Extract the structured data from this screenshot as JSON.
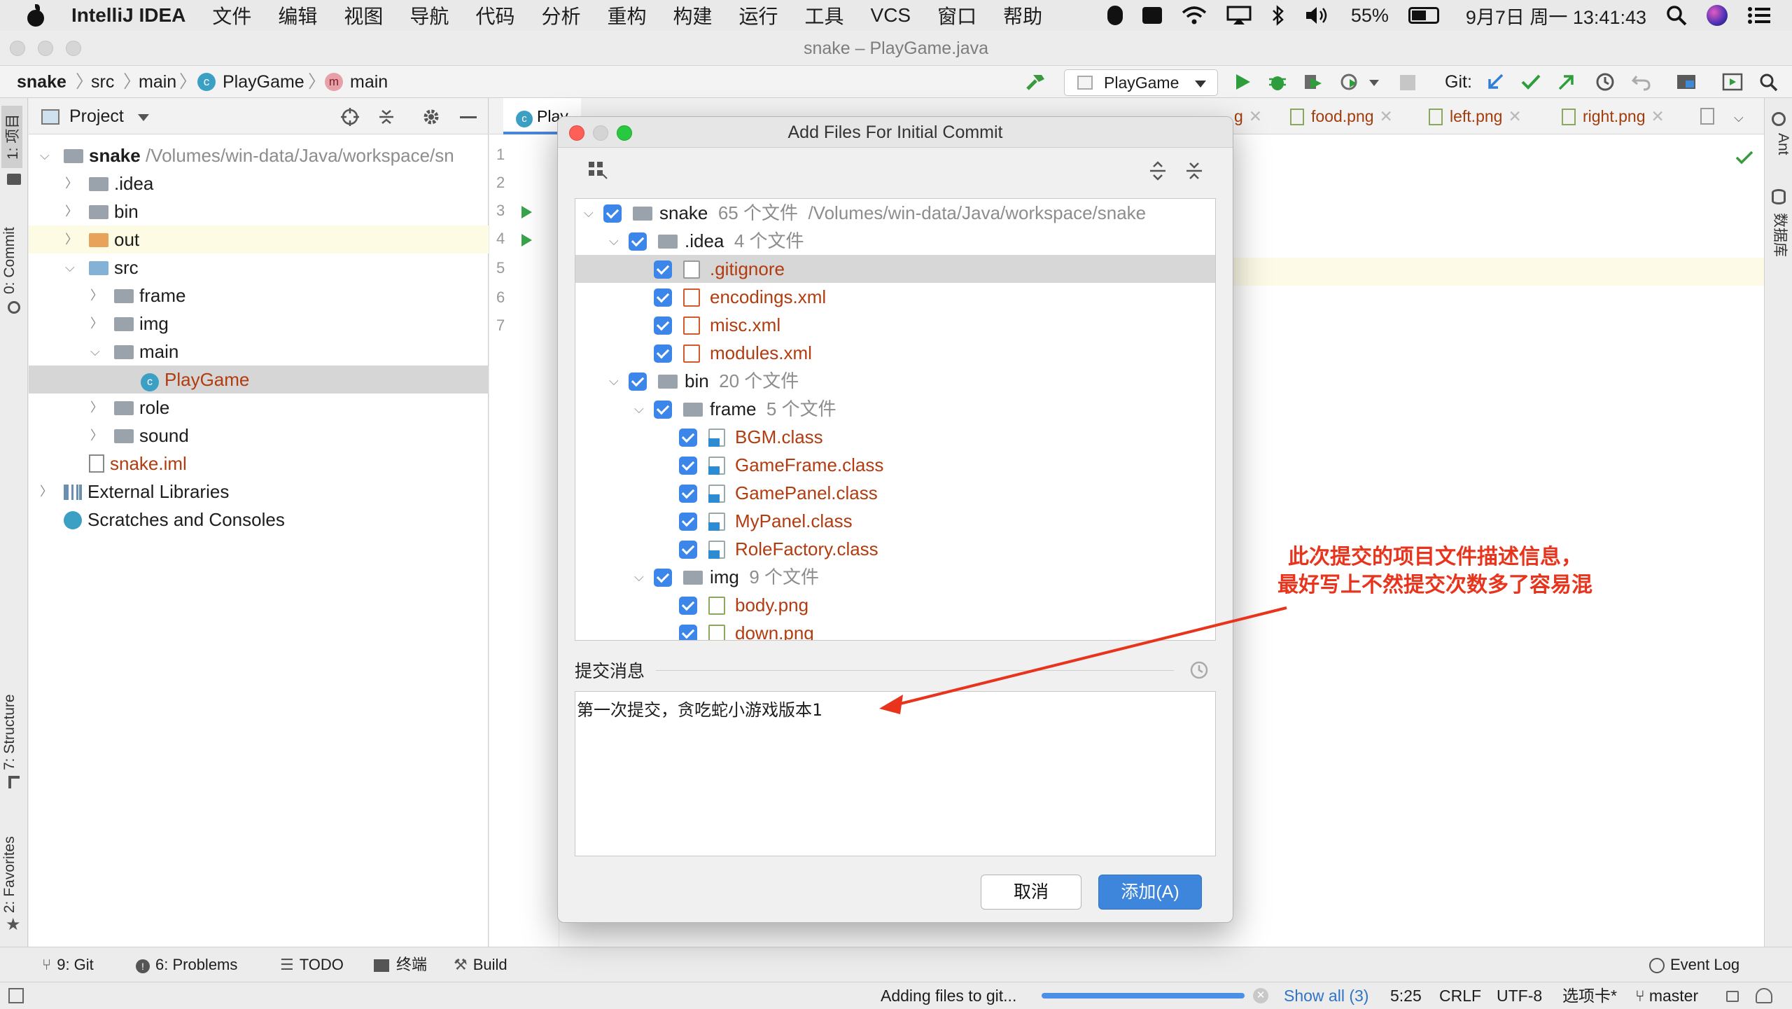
{
  "menubar": {
    "app": "IntelliJ IDEA",
    "items": [
      "文件",
      "编辑",
      "视图",
      "导航",
      "代码",
      "分析",
      "重构",
      "构建",
      "运行",
      "工具",
      "VCS",
      "窗口",
      "帮助"
    ],
    "battery": "55%",
    "clock": "9月7日 周一  13:41:43"
  },
  "window": {
    "title": "snake – PlayGame.java"
  },
  "navbar": {
    "crumbs": [
      "snake",
      "src",
      "main",
      "PlayGame",
      "main"
    ],
    "run_config": "PlayGame",
    "git_label": "Git:"
  },
  "left_stripe": {
    "tabs": [
      "1: 项目",
      "0: Commit",
      "7: Structure",
      "2: Favorites"
    ]
  },
  "right_stripe": {
    "tabs": [
      "Ant",
      "数据库"
    ]
  },
  "project": {
    "title": "Project",
    "tree": [
      {
        "label": "snake",
        "path": "/Volumes/win-data/Java/workspace/sn"
      },
      {
        "label": ".idea"
      },
      {
        "label": "bin"
      },
      {
        "label": "out"
      },
      {
        "label": "src"
      },
      {
        "label": "frame"
      },
      {
        "label": "img"
      },
      {
        "label": "main"
      },
      {
        "label": "PlayGame"
      },
      {
        "label": "role"
      },
      {
        "label": "sound"
      },
      {
        "label": "snake.iml"
      },
      {
        "label": "External Libraries"
      },
      {
        "label": "Scratches and Consoles"
      }
    ]
  },
  "editor": {
    "tabs": [
      "Play",
      "g",
      "food.png",
      "left.png",
      "right.png"
    ],
    "line_numbers": [
      "1",
      "2",
      "3",
      "4",
      "5",
      "6",
      "7"
    ]
  },
  "dialog": {
    "title": "Add Files For Initial Commit",
    "files": [
      {
        "name": "snake",
        "count": "65 个文件",
        "path": "/Volumes/win-data/Java/workspace/snake"
      },
      {
        "name": ".idea",
        "count": "4 个文件"
      },
      {
        "name": ".gitignore"
      },
      {
        "name": "encodings.xml"
      },
      {
        "name": "misc.xml"
      },
      {
        "name": "modules.xml"
      },
      {
        "name": "bin",
        "count": "20 个文件"
      },
      {
        "name": "frame",
        "count": "5 个文件"
      },
      {
        "name": "BGM.class"
      },
      {
        "name": "GameFrame.class"
      },
      {
        "name": "GamePanel.class"
      },
      {
        "name": "MyPanel.class"
      },
      {
        "name": "RoleFactory.class"
      },
      {
        "name": "img",
        "count": "9 个文件"
      },
      {
        "name": "body.png"
      },
      {
        "name": "down.png"
      }
    ],
    "message_label": "提交消息",
    "message": "第一次提交，贪吃蛇小游戏版本1",
    "cancel": "取消",
    "add": "添加(A)"
  },
  "annotation": {
    "line1": "此次提交的项目文件描述信息，",
    "line2": "最好写上不然提交次数多了容易混"
  },
  "bottom_tools": {
    "git": "9: Git",
    "problems": "6: Problems",
    "todo": "TODO",
    "terminal": "终端",
    "build": "Build",
    "event_log": "Event Log"
  },
  "status": {
    "task": "Adding files to git...",
    "progress": 1.0,
    "show_all": "Show all (3)",
    "position": "5:25",
    "line_sep": "CRLF",
    "encoding": "UTF-8",
    "indent": "选项卡*",
    "branch": "master"
  },
  "colors": {
    "accent": "#3b86e8",
    "modified": "#b23c0f",
    "annotation": "#e8341c"
  }
}
